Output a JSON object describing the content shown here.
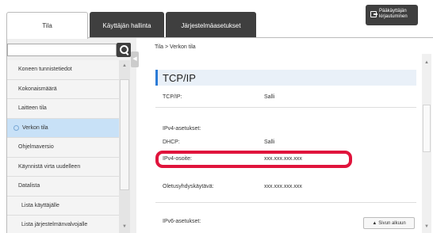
{
  "tabs": [
    {
      "label": "Tila",
      "active": true
    },
    {
      "label": "Käyttäjän hallinta",
      "active": false
    },
    {
      "label": "Järjestelmäasetukset",
      "active": false
    }
  ],
  "admin_login": {
    "line1": "Pääkäyttäjän",
    "line2": "kirjautuminen",
    "icon": "login-icon"
  },
  "search": {
    "value": "",
    "placeholder": "",
    "icon": "search-icon"
  },
  "sidebar": {
    "items": [
      {
        "label": "Koneen tunnistetiedot"
      },
      {
        "label": "Kokonaismäärä"
      },
      {
        "label": "Laitteen tila"
      },
      {
        "label": "Verkon tila",
        "active": true
      },
      {
        "label": "Ohjelmaversio"
      },
      {
        "label": "Käynnistä virta uudelleen"
      },
      {
        "label": "Datalista"
      },
      {
        "label": "Lista käyttäjälle"
      },
      {
        "label": "Lista järjestelmänvalvojalle"
      }
    ]
  },
  "breadcrumb": "Tila >  Verkon tila",
  "section": {
    "title": "TCP/IP"
  },
  "rows": {
    "tcpip": {
      "label": "TCP/IP:",
      "value": "Salli"
    },
    "ipv4_settings": {
      "label": "IPv4-asetukset:"
    },
    "dhcp": {
      "label": "DHCP:",
      "value": "Salli"
    },
    "ipv4_address": {
      "label": "IPv4-osoite:",
      "value": "xxx.xxx.xxx.xxx"
    },
    "gateway": {
      "label": "Oletusyhdyskäytävä:",
      "value": "xxx.xxx.xxx.xxx"
    },
    "ipv6_settings": {
      "label": "IPv6-asetukset:"
    }
  },
  "back_to_top": {
    "label": "Sivun alkuun"
  },
  "colors": {
    "accent": "#2b7bd6",
    "highlight": "#e0143c",
    "active_item": "#c8e1f7",
    "dark_tab": "#3f3f3f"
  }
}
